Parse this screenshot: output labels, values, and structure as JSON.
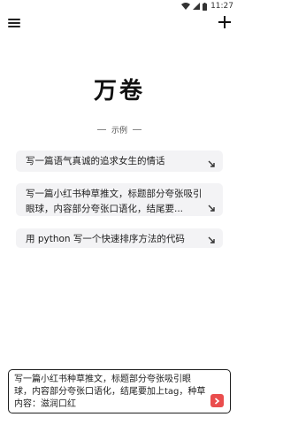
{
  "status_bar": {
    "time": "11:27"
  },
  "app": {
    "title": "万卷"
  },
  "examples": {
    "section_label": "示例",
    "items": [
      {
        "text": "写一篇语气真诚的追求女生的情话"
      },
      {
        "text": "写一篇小红书种草推文，标题部分夸张吸引眼球，内容部分夸张口语化，结尾要..."
      },
      {
        "text": "用 python 写一个快速排序方法的代码"
      }
    ]
  },
  "composer": {
    "value": "写一篇小红书种草推文，标题部分夸张吸引眼球，内容部分夸张口语化，结尾要加上tag，种草内容：滋润口红"
  },
  "colors": {
    "accent": "#ea4d4d",
    "card_bg": "#f3f3f5"
  },
  "icons": [
    "wifi-icon",
    "signal-icon",
    "battery-icon",
    "menu-icon",
    "add-icon",
    "arrow-down-right-icon",
    "send-icon"
  ]
}
